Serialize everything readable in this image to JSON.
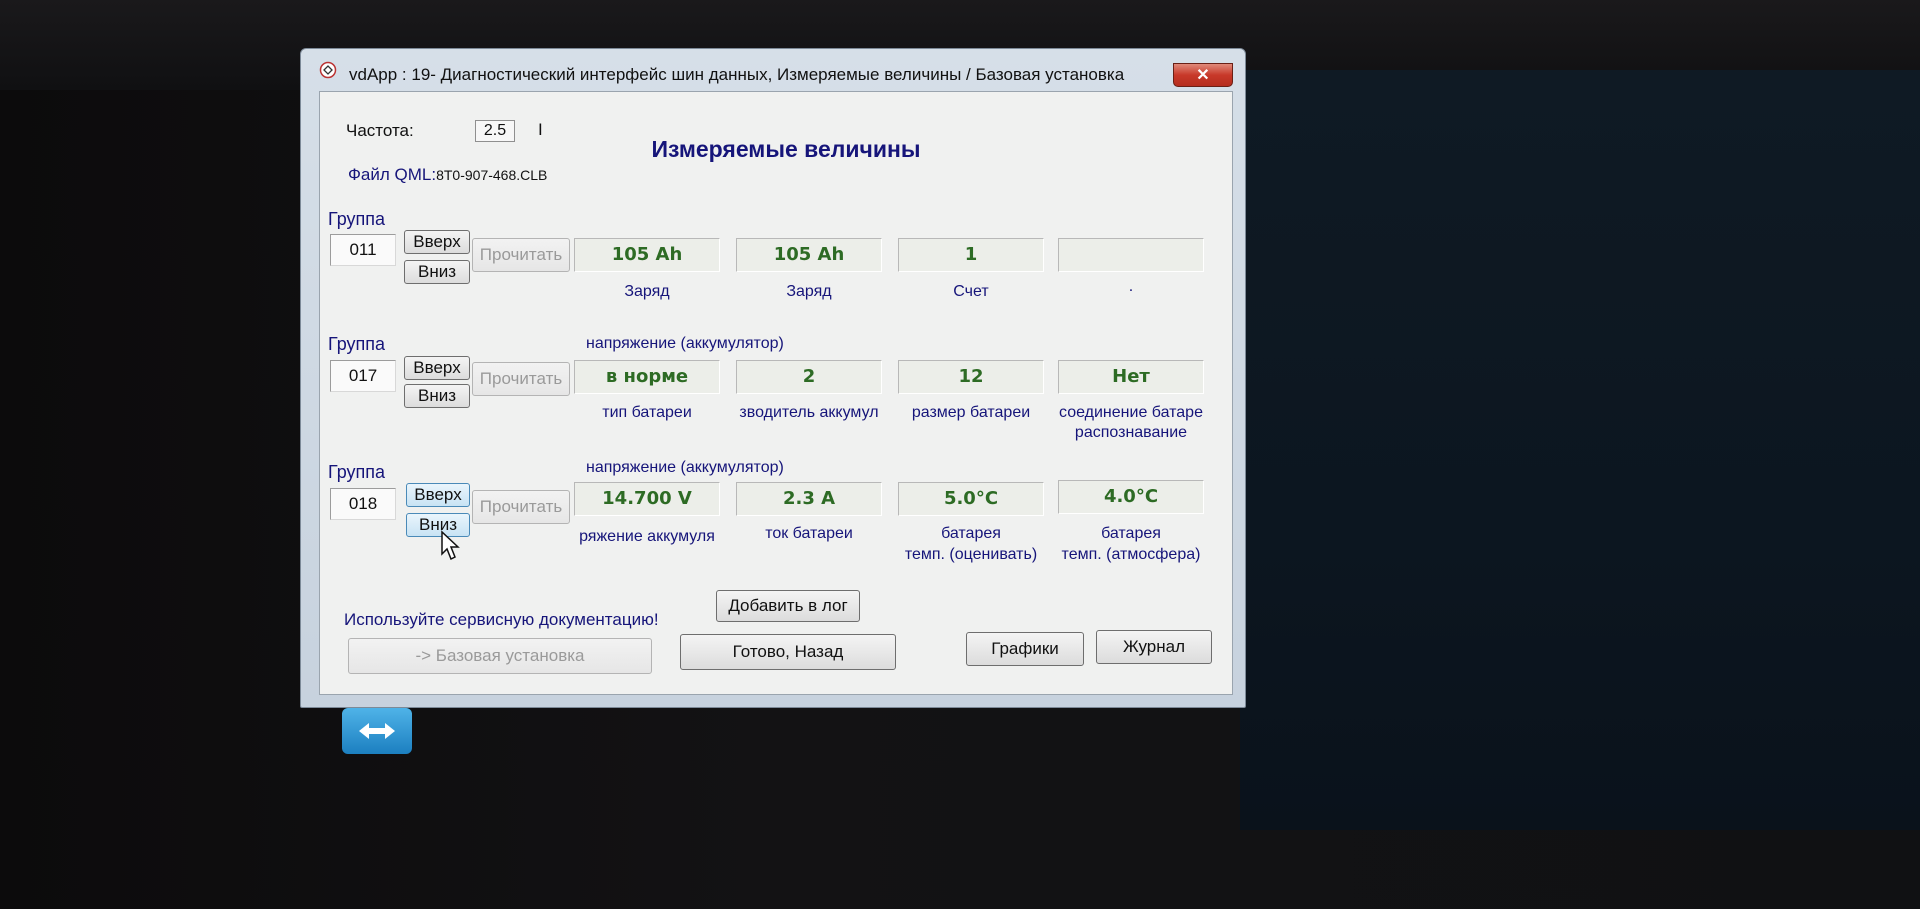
{
  "window": {
    "title": "vdApp : 19- Диагностический интерфейс шин данных,  Измеряемые величины / Базовая установка",
    "close_symbol": "✕"
  },
  "header": {
    "freq_label": "Частота:",
    "freq_value": "2.5",
    "freq_mark": "I",
    "file_label": "Файл QML:",
    "file_value": "8T0-907-468.CLB",
    "main_title": "Измеряемые величины"
  },
  "buttons": {
    "up": "Вверх",
    "down": "Вниз",
    "read": "Прочитать",
    "add_log": "Добавить в лог",
    "basic_setting": "-> Базовая установка",
    "done_back": "Готово, Назад",
    "graphs": "Графики",
    "journal": "Журнал"
  },
  "groups": [
    {
      "label": "Группа",
      "number": "011",
      "subtitle": "",
      "values": [
        "105 Ah",
        "105 Ah",
        "1",
        ""
      ],
      "captions": [
        "Заряд",
        "Заряд",
        "Счет",
        "."
      ],
      "captions2": [
        "",
        "",
        "",
        ""
      ]
    },
    {
      "label": "Группа",
      "number": "017",
      "subtitle": "напряжение (аккумулятор)",
      "values": [
        "в норме",
        "2",
        "12",
        "Нет"
      ],
      "captions": [
        "тип батареи",
        "зводитель аккумул",
        "размер батареи",
        "соединение батаре"
      ],
      "captions2": [
        "",
        "",
        "",
        "распознавание"
      ]
    },
    {
      "label": "Группа",
      "number": "018",
      "subtitle": "напряжение (аккумулятор)",
      "values": [
        "14.700 V",
        "2.3 A",
        "5.0°C",
        "4.0°C"
      ],
      "captions": [
        "ряжение аккумуля",
        "ток батареи",
        "батарея",
        "батарея"
      ],
      "captions2": [
        "",
        "",
        "темп. (оценивать)",
        "темп. (атмосфера)"
      ]
    }
  ],
  "footer": {
    "notice": "Используйте сервисную документацию!"
  },
  "icons": [
    "app-icon",
    "close-icon",
    "teamviewer-icon",
    "mouse-cursor-icon"
  ]
}
